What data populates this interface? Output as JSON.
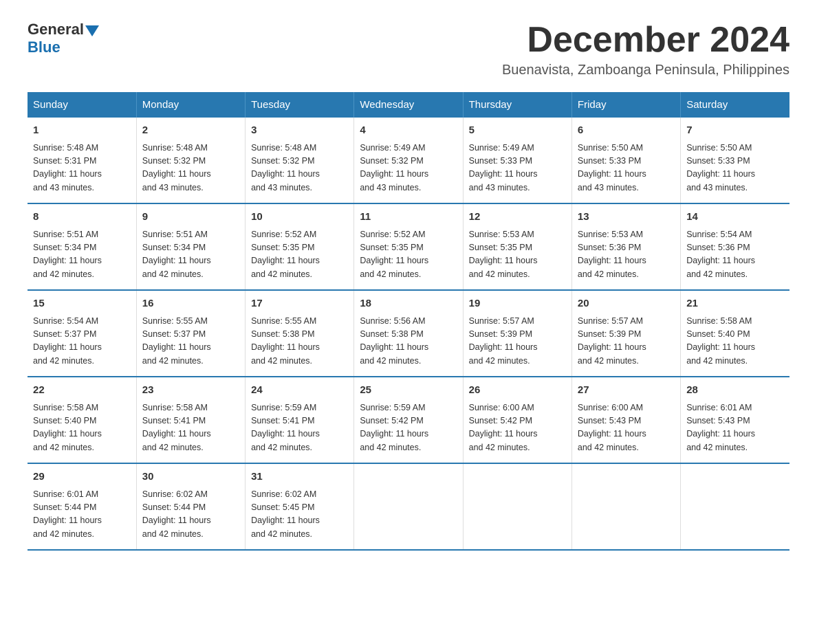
{
  "logo": {
    "general": "General",
    "blue": "Blue"
  },
  "title": "December 2024",
  "location": "Buenavista, Zamboanga Peninsula, Philippines",
  "weekdays": [
    "Sunday",
    "Monday",
    "Tuesday",
    "Wednesday",
    "Thursday",
    "Friday",
    "Saturday"
  ],
  "weeks": [
    [
      {
        "day": "1",
        "sunrise": "5:48 AM",
        "sunset": "5:31 PM",
        "daylight": "11 hours and 43 minutes."
      },
      {
        "day": "2",
        "sunrise": "5:48 AM",
        "sunset": "5:32 PM",
        "daylight": "11 hours and 43 minutes."
      },
      {
        "day": "3",
        "sunrise": "5:48 AM",
        "sunset": "5:32 PM",
        "daylight": "11 hours and 43 minutes."
      },
      {
        "day": "4",
        "sunrise": "5:49 AM",
        "sunset": "5:32 PM",
        "daylight": "11 hours and 43 minutes."
      },
      {
        "day": "5",
        "sunrise": "5:49 AM",
        "sunset": "5:33 PM",
        "daylight": "11 hours and 43 minutes."
      },
      {
        "day": "6",
        "sunrise": "5:50 AM",
        "sunset": "5:33 PM",
        "daylight": "11 hours and 43 minutes."
      },
      {
        "day": "7",
        "sunrise": "5:50 AM",
        "sunset": "5:33 PM",
        "daylight": "11 hours and 43 minutes."
      }
    ],
    [
      {
        "day": "8",
        "sunrise": "5:51 AM",
        "sunset": "5:34 PM",
        "daylight": "11 hours and 42 minutes."
      },
      {
        "day": "9",
        "sunrise": "5:51 AM",
        "sunset": "5:34 PM",
        "daylight": "11 hours and 42 minutes."
      },
      {
        "day": "10",
        "sunrise": "5:52 AM",
        "sunset": "5:35 PM",
        "daylight": "11 hours and 42 minutes."
      },
      {
        "day": "11",
        "sunrise": "5:52 AM",
        "sunset": "5:35 PM",
        "daylight": "11 hours and 42 minutes."
      },
      {
        "day": "12",
        "sunrise": "5:53 AM",
        "sunset": "5:35 PM",
        "daylight": "11 hours and 42 minutes."
      },
      {
        "day": "13",
        "sunrise": "5:53 AM",
        "sunset": "5:36 PM",
        "daylight": "11 hours and 42 minutes."
      },
      {
        "day": "14",
        "sunrise": "5:54 AM",
        "sunset": "5:36 PM",
        "daylight": "11 hours and 42 minutes."
      }
    ],
    [
      {
        "day": "15",
        "sunrise": "5:54 AM",
        "sunset": "5:37 PM",
        "daylight": "11 hours and 42 minutes."
      },
      {
        "day": "16",
        "sunrise": "5:55 AM",
        "sunset": "5:37 PM",
        "daylight": "11 hours and 42 minutes."
      },
      {
        "day": "17",
        "sunrise": "5:55 AM",
        "sunset": "5:38 PM",
        "daylight": "11 hours and 42 minutes."
      },
      {
        "day": "18",
        "sunrise": "5:56 AM",
        "sunset": "5:38 PM",
        "daylight": "11 hours and 42 minutes."
      },
      {
        "day": "19",
        "sunrise": "5:57 AM",
        "sunset": "5:39 PM",
        "daylight": "11 hours and 42 minutes."
      },
      {
        "day": "20",
        "sunrise": "5:57 AM",
        "sunset": "5:39 PM",
        "daylight": "11 hours and 42 minutes."
      },
      {
        "day": "21",
        "sunrise": "5:58 AM",
        "sunset": "5:40 PM",
        "daylight": "11 hours and 42 minutes."
      }
    ],
    [
      {
        "day": "22",
        "sunrise": "5:58 AM",
        "sunset": "5:40 PM",
        "daylight": "11 hours and 42 minutes."
      },
      {
        "day": "23",
        "sunrise": "5:58 AM",
        "sunset": "5:41 PM",
        "daylight": "11 hours and 42 minutes."
      },
      {
        "day": "24",
        "sunrise": "5:59 AM",
        "sunset": "5:41 PM",
        "daylight": "11 hours and 42 minutes."
      },
      {
        "day": "25",
        "sunrise": "5:59 AM",
        "sunset": "5:42 PM",
        "daylight": "11 hours and 42 minutes."
      },
      {
        "day": "26",
        "sunrise": "6:00 AM",
        "sunset": "5:42 PM",
        "daylight": "11 hours and 42 minutes."
      },
      {
        "day": "27",
        "sunrise": "6:00 AM",
        "sunset": "5:43 PM",
        "daylight": "11 hours and 42 minutes."
      },
      {
        "day": "28",
        "sunrise": "6:01 AM",
        "sunset": "5:43 PM",
        "daylight": "11 hours and 42 minutes."
      }
    ],
    [
      {
        "day": "29",
        "sunrise": "6:01 AM",
        "sunset": "5:44 PM",
        "daylight": "11 hours and 42 minutes."
      },
      {
        "day": "30",
        "sunrise": "6:02 AM",
        "sunset": "5:44 PM",
        "daylight": "11 hours and 42 minutes."
      },
      {
        "day": "31",
        "sunrise": "6:02 AM",
        "sunset": "5:45 PM",
        "daylight": "11 hours and 42 minutes."
      },
      null,
      null,
      null,
      null
    ]
  ],
  "labels": {
    "sunrise": "Sunrise:",
    "sunset": "Sunset:",
    "daylight": "Daylight:"
  }
}
